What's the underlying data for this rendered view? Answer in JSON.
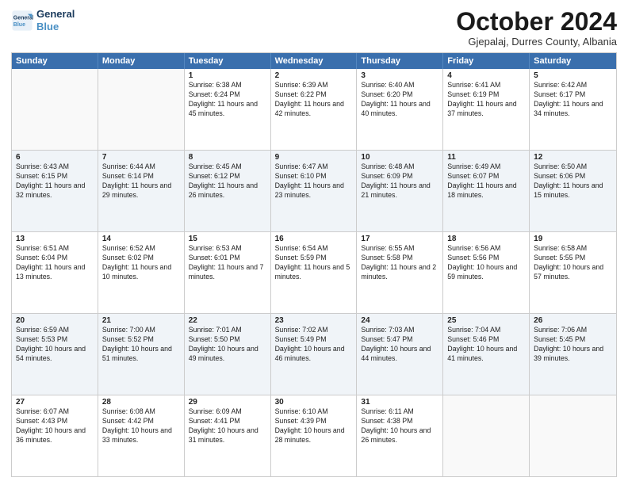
{
  "logo": {
    "line1": "General",
    "line2": "Blue"
  },
  "title": "October 2024",
  "location": "Gjepalaj, Durres County, Albania",
  "days_of_week": [
    "Sunday",
    "Monday",
    "Tuesday",
    "Wednesday",
    "Thursday",
    "Friday",
    "Saturday"
  ],
  "weeks": [
    [
      {
        "day": "",
        "detail": "",
        "empty": true
      },
      {
        "day": "",
        "detail": "",
        "empty": true
      },
      {
        "day": "1",
        "detail": "Sunrise: 6:38 AM\nSunset: 6:24 PM\nDaylight: 11 hours and 45 minutes.",
        "empty": false
      },
      {
        "day": "2",
        "detail": "Sunrise: 6:39 AM\nSunset: 6:22 PM\nDaylight: 11 hours and 42 minutes.",
        "empty": false
      },
      {
        "day": "3",
        "detail": "Sunrise: 6:40 AM\nSunset: 6:20 PM\nDaylight: 11 hours and 40 minutes.",
        "empty": false
      },
      {
        "day": "4",
        "detail": "Sunrise: 6:41 AM\nSunset: 6:19 PM\nDaylight: 11 hours and 37 minutes.",
        "empty": false
      },
      {
        "day": "5",
        "detail": "Sunrise: 6:42 AM\nSunset: 6:17 PM\nDaylight: 11 hours and 34 minutes.",
        "empty": false
      }
    ],
    [
      {
        "day": "6",
        "detail": "Sunrise: 6:43 AM\nSunset: 6:15 PM\nDaylight: 11 hours and 32 minutes.",
        "empty": false
      },
      {
        "day": "7",
        "detail": "Sunrise: 6:44 AM\nSunset: 6:14 PM\nDaylight: 11 hours and 29 minutes.",
        "empty": false
      },
      {
        "day": "8",
        "detail": "Sunrise: 6:45 AM\nSunset: 6:12 PM\nDaylight: 11 hours and 26 minutes.",
        "empty": false
      },
      {
        "day": "9",
        "detail": "Sunrise: 6:47 AM\nSunset: 6:10 PM\nDaylight: 11 hours and 23 minutes.",
        "empty": false
      },
      {
        "day": "10",
        "detail": "Sunrise: 6:48 AM\nSunset: 6:09 PM\nDaylight: 11 hours and 21 minutes.",
        "empty": false
      },
      {
        "day": "11",
        "detail": "Sunrise: 6:49 AM\nSunset: 6:07 PM\nDaylight: 11 hours and 18 minutes.",
        "empty": false
      },
      {
        "day": "12",
        "detail": "Sunrise: 6:50 AM\nSunset: 6:06 PM\nDaylight: 11 hours and 15 minutes.",
        "empty": false
      }
    ],
    [
      {
        "day": "13",
        "detail": "Sunrise: 6:51 AM\nSunset: 6:04 PM\nDaylight: 11 hours and 13 minutes.",
        "empty": false
      },
      {
        "day": "14",
        "detail": "Sunrise: 6:52 AM\nSunset: 6:02 PM\nDaylight: 11 hours and 10 minutes.",
        "empty": false
      },
      {
        "day": "15",
        "detail": "Sunrise: 6:53 AM\nSunset: 6:01 PM\nDaylight: 11 hours and 7 minutes.",
        "empty": false
      },
      {
        "day": "16",
        "detail": "Sunrise: 6:54 AM\nSunset: 5:59 PM\nDaylight: 11 hours and 5 minutes.",
        "empty": false
      },
      {
        "day": "17",
        "detail": "Sunrise: 6:55 AM\nSunset: 5:58 PM\nDaylight: 11 hours and 2 minutes.",
        "empty": false
      },
      {
        "day": "18",
        "detail": "Sunrise: 6:56 AM\nSunset: 5:56 PM\nDaylight: 10 hours and 59 minutes.",
        "empty": false
      },
      {
        "day": "19",
        "detail": "Sunrise: 6:58 AM\nSunset: 5:55 PM\nDaylight: 10 hours and 57 minutes.",
        "empty": false
      }
    ],
    [
      {
        "day": "20",
        "detail": "Sunrise: 6:59 AM\nSunset: 5:53 PM\nDaylight: 10 hours and 54 minutes.",
        "empty": false
      },
      {
        "day": "21",
        "detail": "Sunrise: 7:00 AM\nSunset: 5:52 PM\nDaylight: 10 hours and 51 minutes.",
        "empty": false
      },
      {
        "day": "22",
        "detail": "Sunrise: 7:01 AM\nSunset: 5:50 PM\nDaylight: 10 hours and 49 minutes.",
        "empty": false
      },
      {
        "day": "23",
        "detail": "Sunrise: 7:02 AM\nSunset: 5:49 PM\nDaylight: 10 hours and 46 minutes.",
        "empty": false
      },
      {
        "day": "24",
        "detail": "Sunrise: 7:03 AM\nSunset: 5:47 PM\nDaylight: 10 hours and 44 minutes.",
        "empty": false
      },
      {
        "day": "25",
        "detail": "Sunrise: 7:04 AM\nSunset: 5:46 PM\nDaylight: 10 hours and 41 minutes.",
        "empty": false
      },
      {
        "day": "26",
        "detail": "Sunrise: 7:06 AM\nSunset: 5:45 PM\nDaylight: 10 hours and 39 minutes.",
        "empty": false
      }
    ],
    [
      {
        "day": "27",
        "detail": "Sunrise: 6:07 AM\nSunset: 4:43 PM\nDaylight: 10 hours and 36 minutes.",
        "empty": false
      },
      {
        "day": "28",
        "detail": "Sunrise: 6:08 AM\nSunset: 4:42 PM\nDaylight: 10 hours and 33 minutes.",
        "empty": false
      },
      {
        "day": "29",
        "detail": "Sunrise: 6:09 AM\nSunset: 4:41 PM\nDaylight: 10 hours and 31 minutes.",
        "empty": false
      },
      {
        "day": "30",
        "detail": "Sunrise: 6:10 AM\nSunset: 4:39 PM\nDaylight: 10 hours and 28 minutes.",
        "empty": false
      },
      {
        "day": "31",
        "detail": "Sunrise: 6:11 AM\nSunset: 4:38 PM\nDaylight: 10 hours and 26 minutes.",
        "empty": false
      },
      {
        "day": "",
        "detail": "",
        "empty": true
      },
      {
        "day": "",
        "detail": "",
        "empty": true
      }
    ]
  ],
  "alt_rows": [
    1,
    3
  ]
}
